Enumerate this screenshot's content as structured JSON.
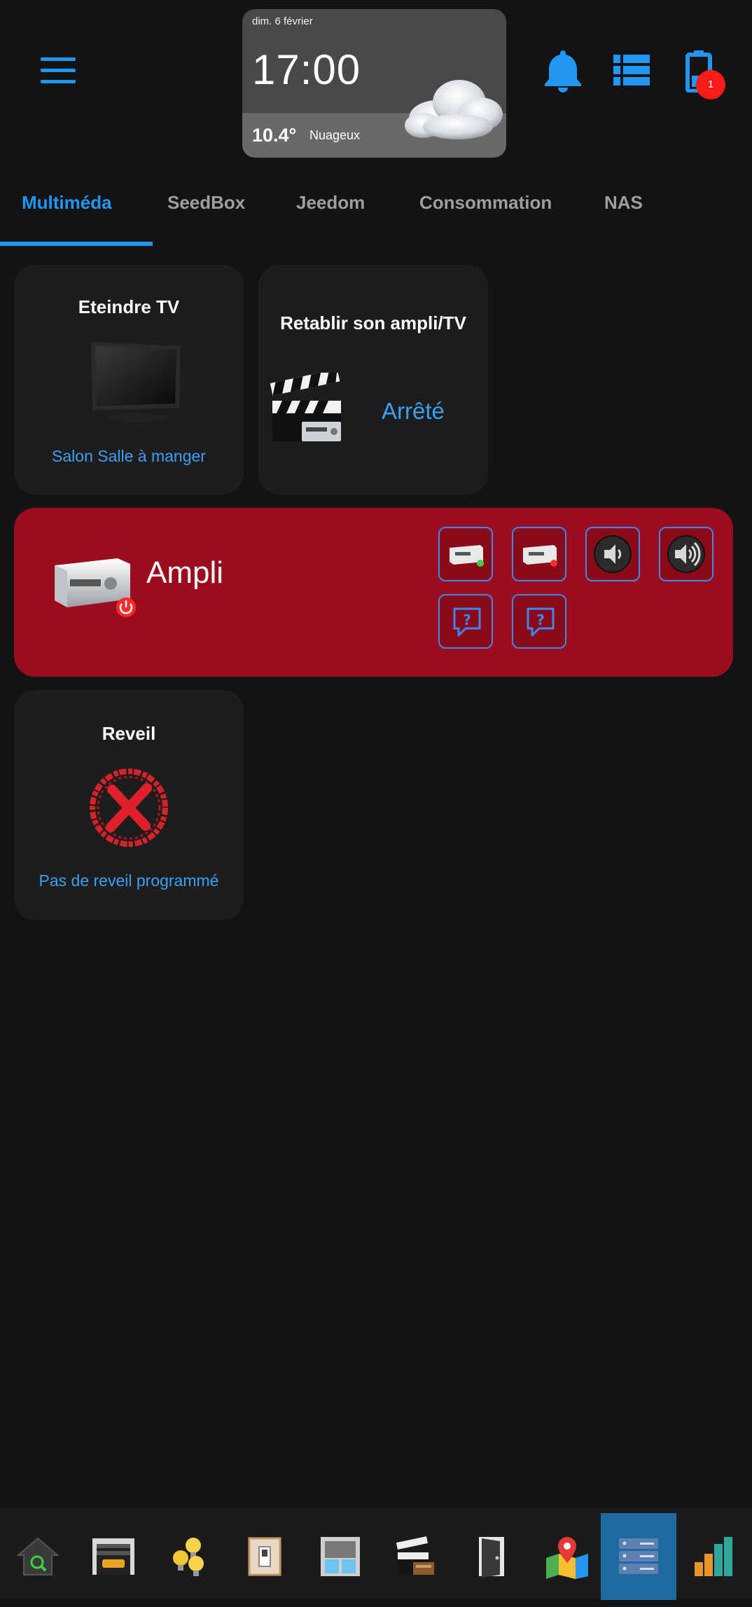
{
  "header": {
    "date": "dim. 6 février",
    "time": "17:00",
    "temperature": "10.4°",
    "condition": "Nuageux",
    "notification_count": "1",
    "icons": [
      "menu-icon",
      "cloud-icon",
      "bell-icon",
      "list-icon",
      "battery-icon"
    ]
  },
  "tabs": [
    {
      "label": "Multiméda",
      "active": true
    },
    {
      "label": "SeedBox",
      "active": false
    },
    {
      "label": "Jeedom",
      "active": false
    },
    {
      "label": "Consommation",
      "active": false
    },
    {
      "label": "NAS",
      "active": false
    }
  ],
  "cards": {
    "tv": {
      "title": "Eteindre TV",
      "subtitle": "Salon Salle à manger",
      "icon": "tv-icon"
    },
    "ampli_tv": {
      "title": "Retablir son ampli/TV",
      "status": "Arrêté",
      "icon": "clapperboard-icon"
    },
    "ampli": {
      "title": "Ampli",
      "icon": "amplifier-power-icon",
      "buttons": [
        "amplifier-on-icon",
        "amplifier-off-icon",
        "volume-down-icon",
        "volume-up-icon",
        "question-icon",
        "question-icon"
      ]
    },
    "reveil": {
      "title": "Reveil",
      "subtitle": "Pas de reveil programmé",
      "icon": "no-alarm-icon"
    }
  },
  "bottom_nav": [
    {
      "icon": "home-search-icon",
      "active": false
    },
    {
      "icon": "garage-icon",
      "active": false
    },
    {
      "icon": "light-bulbs-icon",
      "active": false
    },
    {
      "icon": "switch-icon",
      "active": false
    },
    {
      "icon": "window-shutter-icon",
      "active": false
    },
    {
      "icon": "multimedia-icon",
      "active": false
    },
    {
      "icon": "door-icon",
      "active": false
    },
    {
      "icon": "map-icon",
      "active": false
    },
    {
      "icon": "server-icon",
      "active": true
    },
    {
      "icon": "bar-chart-icon",
      "active": false
    }
  ],
  "colors": {
    "accent": "#2196f3",
    "background": "#131314",
    "card": "#1d1d1e",
    "ampli_card": "#9b0c1e",
    "badge": "#ff1a1a"
  }
}
